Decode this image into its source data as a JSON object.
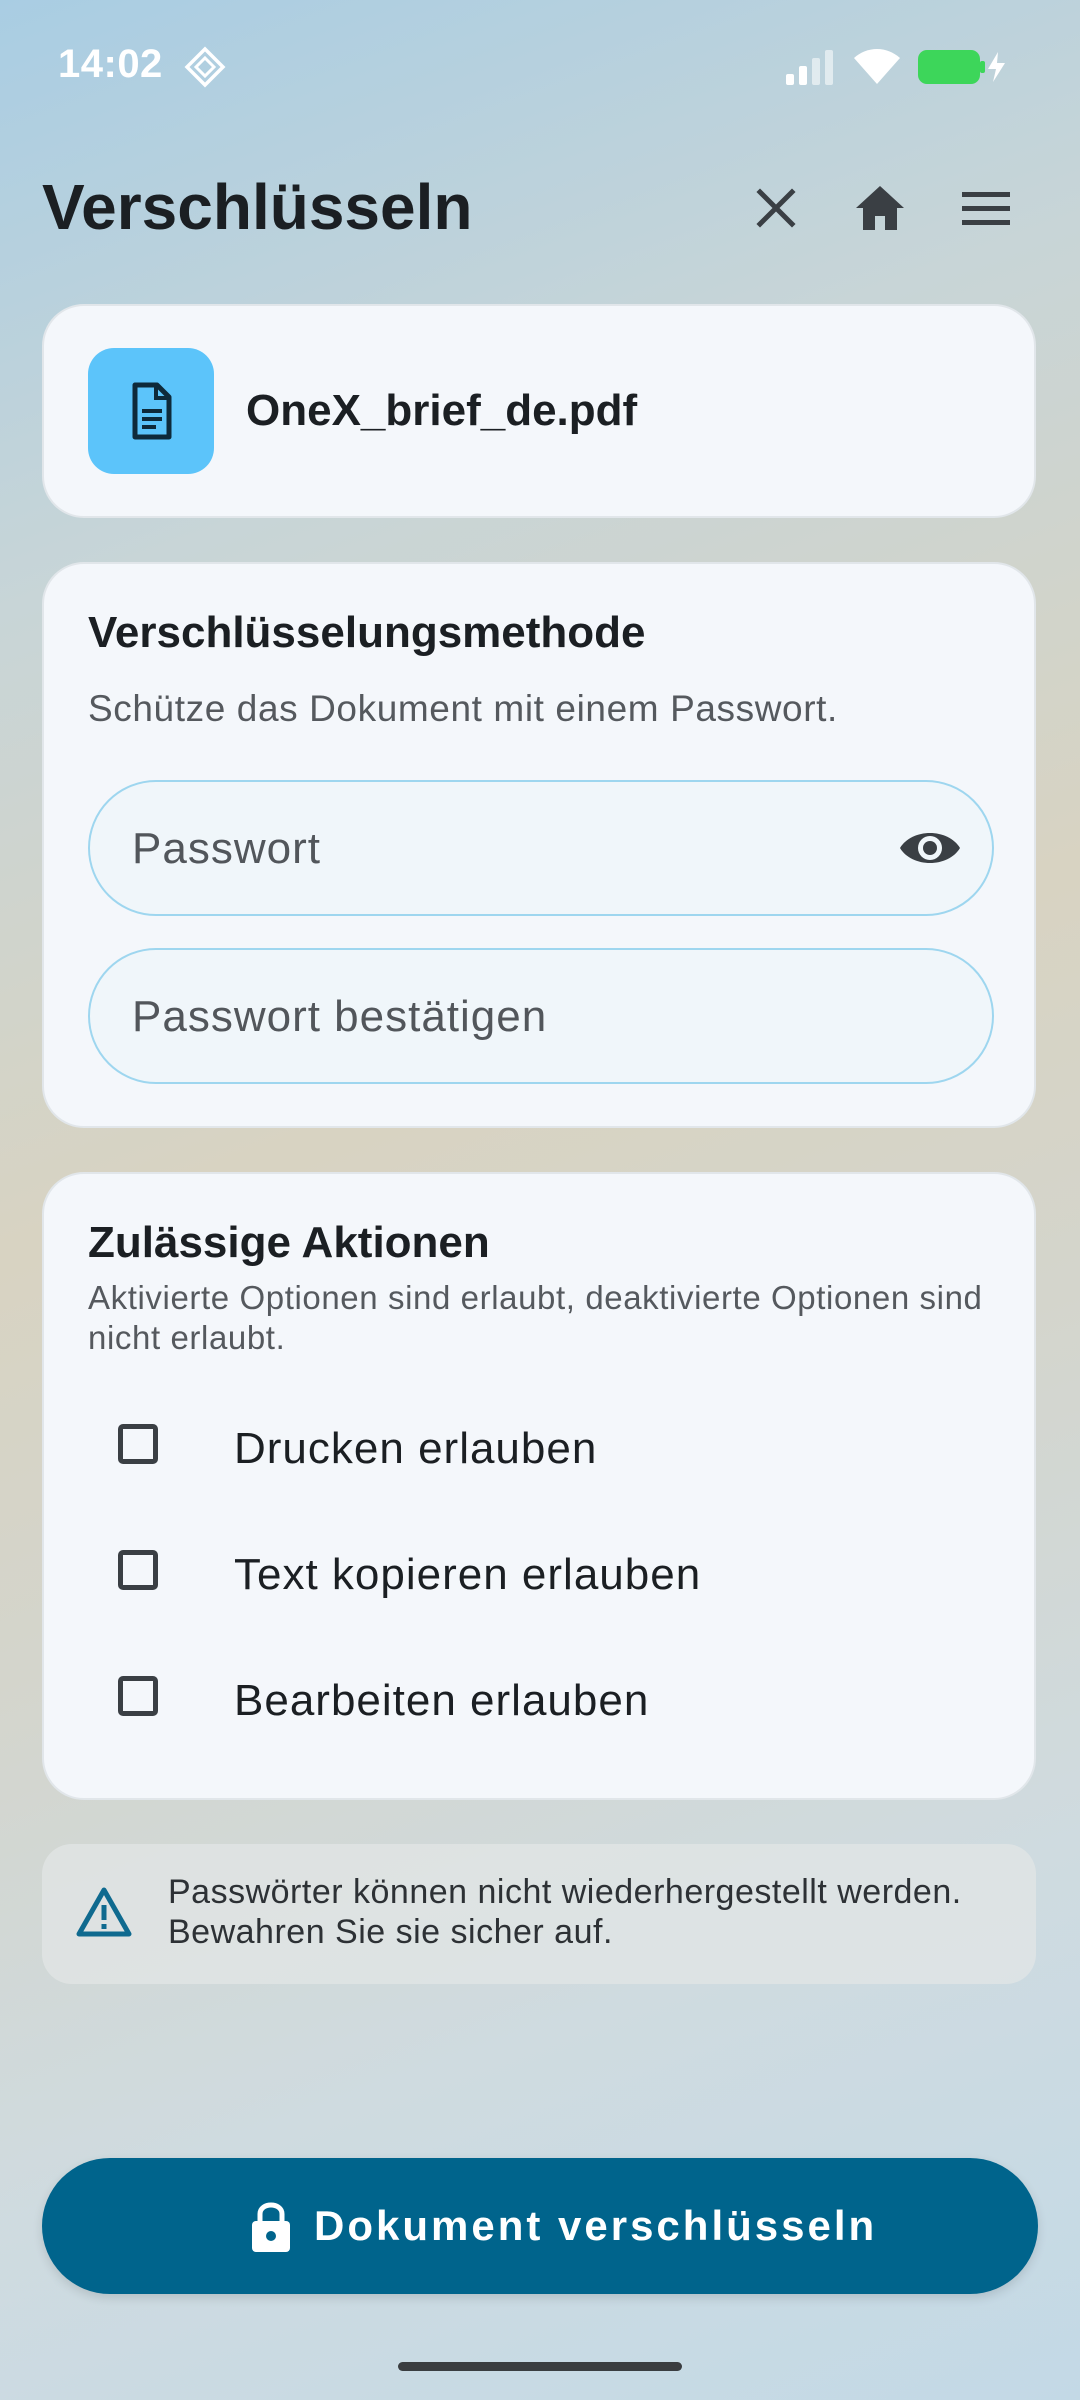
{
  "status_bar": {
    "time": "14:02"
  },
  "header": {
    "title": "Verschlüsseln"
  },
  "file": {
    "name": "OneX_brief_de.pdf"
  },
  "method": {
    "heading": "Verschlüsselungsmethode",
    "description": "Schütze das Dokument mit einem Passwort.",
    "password_placeholder": "Passwort",
    "password_value": "",
    "confirm_placeholder": "Passwort bestätigen",
    "confirm_value": ""
  },
  "actions": {
    "heading": "Zulässige Aktionen",
    "description": "Aktivierte Optionen sind erlaubt, deaktivierte Optionen sind nicht erlaubt.",
    "options": [
      {
        "label": "Drucken erlauben",
        "checked": false
      },
      {
        "label": "Text kopieren erlauben",
        "checked": false
      },
      {
        "label": "Bearbeiten erlauben",
        "checked": false
      }
    ]
  },
  "notice": {
    "text": "Passwörter können nicht wiederhergestellt werden. Bewahren Sie sie sicher auf."
  },
  "primary_button": {
    "label": "Dokument verschlüsseln"
  },
  "colors": {
    "accent": "#00648c",
    "file_icon_bg": "#5cc4fa",
    "input_border": "#9ed6ef",
    "card_bg": "#f4f7fb",
    "warning_icon": "#0f6a8f"
  },
  "icons": {
    "status": [
      "diamond-icon",
      "signal-icon",
      "wifi-icon",
      "battery-charging-icon"
    ],
    "header": [
      "close-icon",
      "home-icon",
      "menu-icon"
    ],
    "file": "document-icon",
    "password": "eye-icon",
    "notice": "warning-icon",
    "button": "lock-icon"
  }
}
